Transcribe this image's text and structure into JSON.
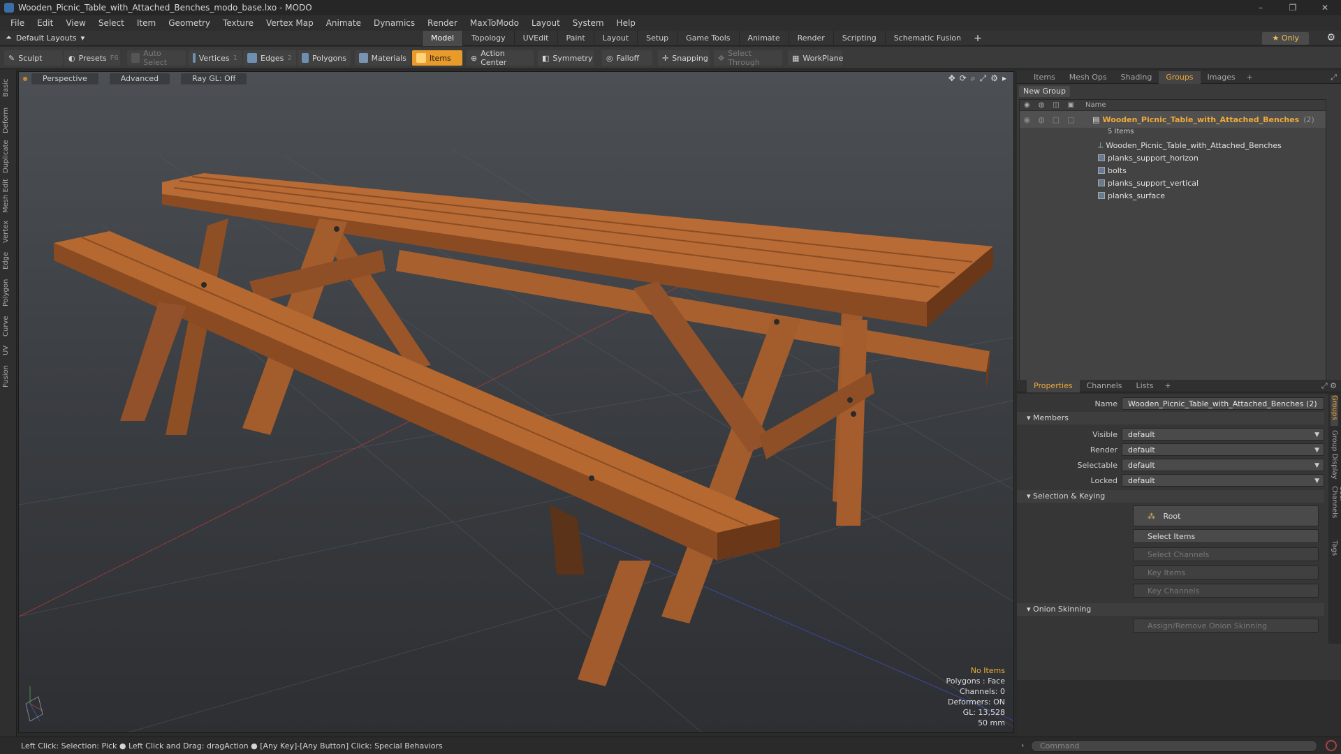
{
  "window": {
    "title": "Wooden_Picnic_Table_with_Attached_Benches_modo_base.lxo - MODO",
    "controls": [
      "–",
      "❐",
      "✕"
    ]
  },
  "menu": [
    "File",
    "Edit",
    "View",
    "Select",
    "Item",
    "Geometry",
    "Texture",
    "Vertex Map",
    "Animate",
    "Dynamics",
    "Render",
    "MaxToModo",
    "Layout",
    "System",
    "Help"
  ],
  "layout_bar": {
    "layout_select": "Default Layouts",
    "tabs": [
      "Model",
      "Topology",
      "UVEdit",
      "Paint",
      "Layout",
      "Setup",
      "Game Tools",
      "Animate",
      "Render",
      "Scripting",
      "Schematic Fusion"
    ],
    "active_tab": "Model",
    "only_label": "Only"
  },
  "toolbar": {
    "sculpt": "Sculpt",
    "presets": "Presets",
    "presets_key": "F6",
    "auto_select": "Auto Select",
    "vertices": "Vertices",
    "vertices_key": "1",
    "edges": "Edges",
    "edges_key": "2",
    "polygons": "Polygons",
    "materials": "Materials",
    "items": "Items",
    "action_center": "Action Center",
    "symmetry": "Symmetry",
    "falloff": "Falloff",
    "snapping": "Snapping",
    "select_through": "Select Through",
    "workplane": "WorkPlane"
  },
  "left_tabs": [
    "Basic",
    "Deform",
    "Duplicate",
    "Mesh Edit",
    "Vertex",
    "Edge",
    "Polygon",
    "Curve",
    "UV",
    "Fusion"
  ],
  "viewport": {
    "view_mode": "Perspective",
    "shading": "Advanced",
    "raygl": "Ray GL: Off",
    "info": {
      "no_items": "No Items",
      "polygons": "Polygons : Face",
      "channels": "Channels: 0",
      "deformers": "Deformers: ON",
      "gl": "GL: 13,528",
      "lens": "50 mm"
    }
  },
  "groups_panel": {
    "tabs": [
      "Items",
      "Mesh Ops",
      "Shading",
      "Groups",
      "Images"
    ],
    "active_tab": "Groups",
    "new_group": "New Group",
    "name_header": "Name",
    "parent": {
      "name": "Wooden_Picnic_Table_with_Attached_Benches",
      "count": "(2)",
      "sub": "5 Items"
    },
    "children": [
      "Wooden_Picnic_Table_with_Attached_Benches",
      "planks_support_horizon",
      "bolts",
      "planks_support_vertical",
      "planks_surface"
    ]
  },
  "properties_panel": {
    "tabs": [
      "Properties",
      "Channels",
      "Lists"
    ],
    "active_tab": "Properties",
    "name_label": "Name",
    "name_value": "Wooden_Picnic_Table_with_Attached_Benches (2)",
    "members_section": "Members",
    "visible_label": "Visible",
    "visible_value": "default",
    "render_label": "Render",
    "render_value": "default",
    "selectable_label": "Selectable",
    "selectable_value": "default",
    "locked_label": "Locked",
    "locked_value": "default",
    "selection_section": "Selection & Keying",
    "root_button": "Root",
    "select_items": "Select Items",
    "select_channels": "Select Channels",
    "key_items": "Key Items",
    "key_channels": "Key Channels",
    "onion_section": "Onion Skinning",
    "onion_button": "Assign/Remove Onion Skinning",
    "side_tabs": [
      "Groups",
      "Group Display",
      "User Channels",
      "Tags"
    ]
  },
  "status_bar": {
    "hint": "Left Click: Selection: Pick ● Left Click and Drag: dragAction ● [Any Key]-[Any Button] Click: Special Behaviors",
    "command_placeholder": "Command"
  },
  "colors": {
    "accent": "#e89b2a",
    "wood": "#b86b34",
    "wood_dark": "#7a4320"
  }
}
